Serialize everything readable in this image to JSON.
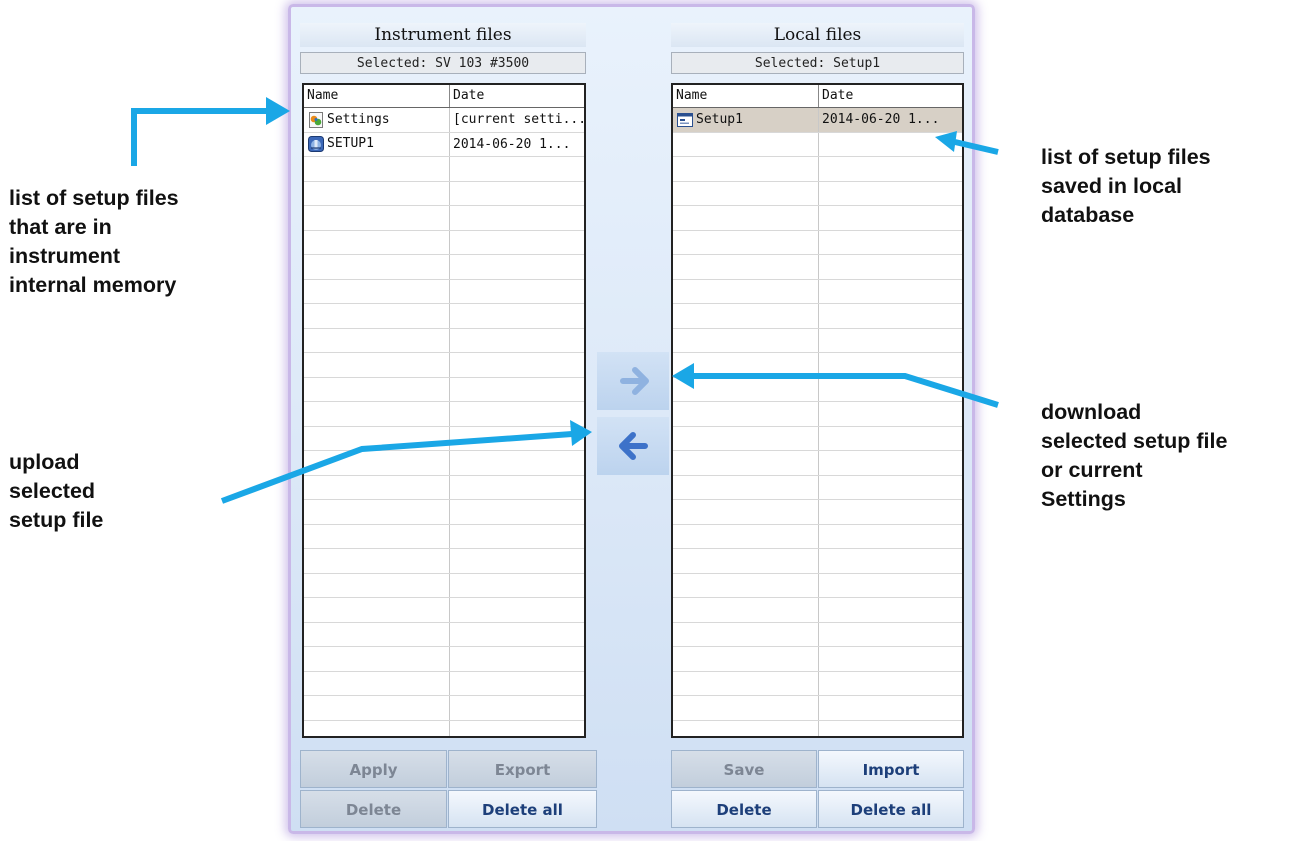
{
  "instrument_panel": {
    "title": "Instrument files",
    "selected": "Selected: SV 103 #3500",
    "headers": {
      "name": "Name",
      "date": "Date"
    },
    "rows": [
      {
        "name": "Settings",
        "date": "[current setti...",
        "icon": "settings-file-icon"
      },
      {
        "name": "SETUP1",
        "date": "2014-06-20 1...",
        "icon": "instrument-setup-icon"
      }
    ],
    "buttons": {
      "apply": "Apply",
      "export": "Export",
      "delete": "Delete",
      "delete_all": "Delete all"
    }
  },
  "local_panel": {
    "title": "Local files",
    "selected": "Selected: Setup1",
    "headers": {
      "name": "Name",
      "date": "Date"
    },
    "rows": [
      {
        "name": "Setup1",
        "date": "2014-06-20 1...",
        "icon": "setup-file-icon",
        "selected": true
      }
    ],
    "buttons": {
      "save": "Save",
      "import": "Import",
      "delete": "Delete",
      "delete_all": "Delete all"
    }
  },
  "transfer": {
    "download_icon": "arrow-right-icon",
    "upload_icon": "arrow-left-icon"
  },
  "annotations": {
    "instrument_list": "list of setup files\nthat are in\ninstrument\ninternal  memory",
    "local_list": "list of setup files\nsaved in local\ndatabase",
    "upload": "upload\nselected\nsetup file",
    "download": "download\nselected setup file\nor current\nSettings"
  },
  "colors": {
    "annotation_arrow": "#1aa7e6",
    "selected_row": "#d7d0c6",
    "button_text": "#1d3f7a",
    "disabled_text": "#7d8694"
  }
}
